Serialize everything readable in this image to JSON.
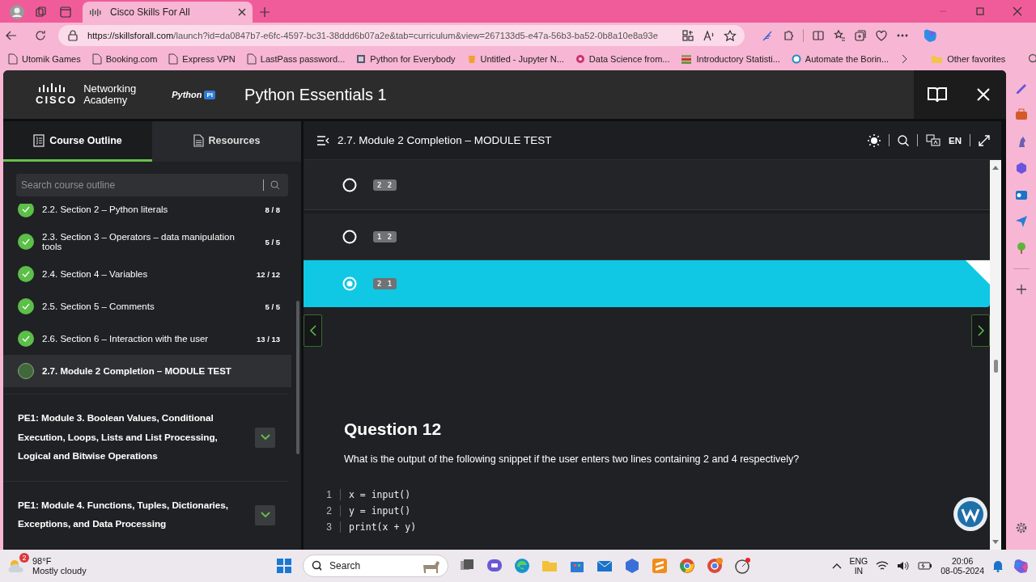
{
  "browser": {
    "tabs": [
      {
        "title": "Cisco Skills For All",
        "selected": true
      }
    ],
    "url": {
      "host": "https://skillsforall.com",
      "path": "/launch?id=da0847b7-e6fc-4597-bc31-38ddd6b07a2e&tab=curriculum&view=267133d5-e47a-56b3-ba52-0b8a10e8a93e"
    },
    "bookmarks": [
      {
        "label": "Utomik Games",
        "kind": "page"
      },
      {
        "label": "Booking.com",
        "kind": "page"
      },
      {
        "label": "Express VPN",
        "kind": "page"
      },
      {
        "label": "LastPass password...",
        "kind": "page"
      },
      {
        "label": "Python for Everybody",
        "kind": "site"
      },
      {
        "label": "Untitled - Jupyter N...",
        "kind": "jupyter"
      },
      {
        "label": "Data Science from...",
        "kind": "ring"
      },
      {
        "label": "Introductory Statisti...",
        "kind": "books"
      },
      {
        "label": "Automate the Borin...",
        "kind": "wordpress"
      }
    ],
    "other_favorites": "Other favorites"
  },
  "app": {
    "logo": {
      "line1": "Networking",
      "line2": "Academy",
      "mark": "CISCO",
      "partner": "Python",
      "partner_badge": "PI"
    },
    "course_title": "Python Essentials 1"
  },
  "sidebar": {
    "tabs": [
      {
        "label": "Course Outline",
        "selected": true
      },
      {
        "label": "Resources",
        "selected": false
      }
    ],
    "search": {
      "placeholder": "Search course outline"
    },
    "items": [
      {
        "label": "2.2. Section 2 – Python literals",
        "count": "8 / 8",
        "complete": true,
        "selected": false
      },
      {
        "label": "2.3. Section 3 – Operators – data manipulation tools",
        "count": "5 / 5",
        "complete": true,
        "selected": false
      },
      {
        "label": "2.4. Section 4 – Variables",
        "count": "12 / 12",
        "complete": true,
        "selected": false
      },
      {
        "label": "2.5. Section 5 – Comments",
        "count": "5 / 5",
        "complete": true,
        "selected": false
      },
      {
        "label": "2.6. Section 6 – Interaction with the user",
        "count": "13 / 13",
        "complete": true,
        "selected": false
      },
      {
        "label": "2.7. Module 2 Completion – MODULE TEST",
        "complete": false,
        "selected": true
      }
    ],
    "modules": [
      {
        "title": "PE1: Module 3. Boolean Values, Conditional Execution, Loops, Lists and List Processing, Logical and Bitwise Operations",
        "expanded": false
      },
      {
        "title": "PE1: Module 4. Functions, Tuples, Dictionaries, Exceptions, and Data Processing",
        "expanded": false
      }
    ]
  },
  "lesson": {
    "title": "2.7. Module 2 Completion – MODULE TEST",
    "language": "EN",
    "options": [
      {
        "answer": "2 2",
        "selected": false
      },
      {
        "answer": "1 2",
        "selected": false
      },
      {
        "answer": "2 1",
        "selected": true
      }
    ],
    "question": {
      "title": "Question 12",
      "text": "What is the output of the following snippet if the user enters two lines containing 2 and 4 respectively?",
      "code": [
        {
          "line": "1",
          "text": "x = input()"
        },
        {
          "line": "2",
          "text": "y = input()"
        },
        {
          "line": "3",
          "text": "print(x + y)"
        }
      ]
    }
  },
  "taskbar": {
    "weather": {
      "temperature": "98°F",
      "condition": "Mostly cloudy",
      "badge": "2"
    },
    "search": {
      "placeholder": "Search"
    },
    "language": {
      "line1": "ENG",
      "line2": "IN"
    },
    "time": "20:06",
    "date": "08-05-2024"
  }
}
